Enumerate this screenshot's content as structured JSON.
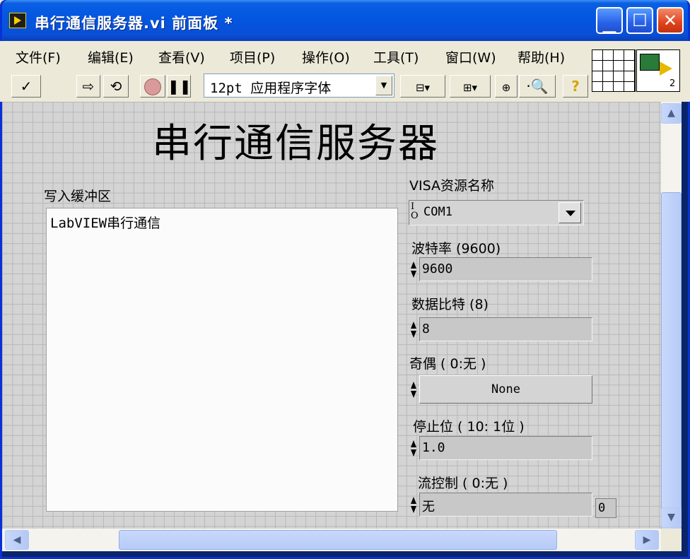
{
  "window": {
    "title": "串行通信服务器.vi 前面板 *",
    "buttons": {
      "minimize": "_",
      "maximize": "□",
      "close": "✕"
    }
  },
  "menubar": [
    "文件(F)",
    "编辑(E)",
    "查看(V)",
    "项目(P)",
    "操作(O)",
    "工具(T)",
    "窗口(W)",
    "帮助(H)"
  ],
  "toolbar": {
    "run_check": "✓",
    "font": "12pt 应用程序字体",
    "help": "?"
  },
  "vi_icon": {
    "number": "2"
  },
  "panel": {
    "title": "串行通信服务器",
    "write_buffer": {
      "label": "写入缓冲区",
      "value": "LabVIEW串行通信"
    },
    "visa": {
      "label": "VISA资源名称",
      "io_mark_top": "I",
      "io_mark_bottom": "O",
      "value": "COM1"
    },
    "baud_rate": {
      "label": "波特率 (9600)",
      "value": "9600"
    },
    "data_bits": {
      "label": "数据比特 (8)",
      "value": "8"
    },
    "parity": {
      "label": "奇偶 ( 0:无 )",
      "value": "None"
    },
    "stop_bits": {
      "label": "停止位 ( 10:  1位 )",
      "value": "1.0"
    },
    "flow_control": {
      "label": "流控制 ( 0:无 )",
      "value": "无",
      "aux_value": "0"
    }
  },
  "colors": {
    "titlebar": "#0356e0",
    "panel_bg": "#d4d4d4",
    "grid": "#b8b8b8"
  }
}
